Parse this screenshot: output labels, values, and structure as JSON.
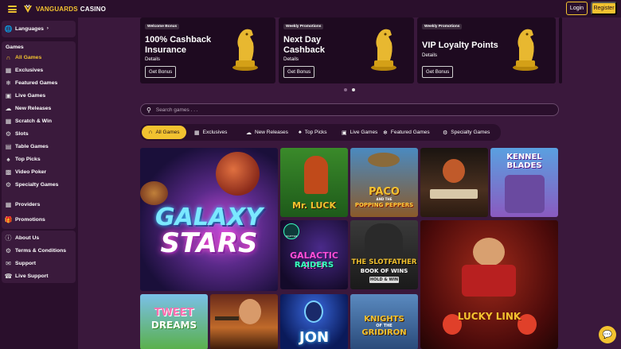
{
  "header": {
    "brand_prefix": "VANGUARDS",
    "brand_suffix": "CASINO",
    "login_label": "Login",
    "register_label": "Register",
    "accent": "#f2c230"
  },
  "sidebar": {
    "languages_label": "Languages",
    "games_heading": "Games",
    "games": [
      {
        "label": "All Games",
        "icon": "horseshoe-icon",
        "active": true
      },
      {
        "label": "Exclusives",
        "icon": "cards-icon"
      },
      {
        "label": "Featured Games",
        "icon": "featured-icon"
      },
      {
        "label": "Live Games",
        "icon": "live-icon"
      },
      {
        "label": "New Releases",
        "icon": "new-icon"
      },
      {
        "label": "Scratch & Win",
        "icon": "scratch-icon"
      },
      {
        "label": "Slots",
        "icon": "slots-icon"
      },
      {
        "label": "Table Games",
        "icon": "table-icon"
      },
      {
        "label": "Top Picks",
        "icon": "top-picks-icon"
      },
      {
        "label": "Video Poker",
        "icon": "video-poker-icon"
      },
      {
        "label": "Specialty Games",
        "icon": "specialty-icon"
      }
    ],
    "providers_label": "Providers",
    "promotions_label": "Promotions",
    "info": [
      {
        "label": "About Us",
        "icon": "info-icon"
      },
      {
        "label": "Terms & Conditions",
        "icon": "terms-icon"
      },
      {
        "label": "Support",
        "icon": "support-icon"
      },
      {
        "label": "Live Support",
        "icon": "live-support-icon"
      }
    ]
  },
  "promos": [
    {
      "tag": "Welcome Bonus",
      "title_line1": "100% Cashback",
      "title_line2": "Insurance",
      "details": "Details",
      "button": "Get Bonus"
    },
    {
      "tag": "Weekly Promotions",
      "title_line1": "Next Day",
      "title_line2": "Cashback",
      "details": "Details",
      "button": "Get Bonus"
    },
    {
      "tag": "Weekly Promotions",
      "title_line1": "VIP Loyalty Points",
      "title_line2": "",
      "details": "Details",
      "button": "Get Bonus"
    }
  ],
  "search": {
    "placeholder": "Search games . . ."
  },
  "tabs": [
    {
      "label": "All Games",
      "active": true
    },
    {
      "label": "Exclusives"
    },
    {
      "label": "New Releases"
    },
    {
      "label": "Top Picks"
    },
    {
      "label": "Live Games"
    },
    {
      "label": "Featured Games"
    },
    {
      "label": "Specialty Games"
    }
  ],
  "games": {
    "galaxy_stars": {
      "line1": "GALAXY",
      "line2": "STARS"
    },
    "mr_luck": "Mr. LUCK",
    "paco": {
      "line1": "PACO",
      "line2": "AND THE",
      "line3": "POPPING PEPPERS"
    },
    "kennel_blades": {
      "line1": "KENNEL",
      "line2": "BLADES"
    },
    "galactic_rift": {
      "badge": "SCATTER",
      "line1": "GALACTIC RIFT",
      "line2": "RAIDERS"
    },
    "slotfather": {
      "line1": "THE SLOTFATHER",
      "line2": "BOOK OF WINS",
      "line3": "HOLD & WIN"
    },
    "lucky_link": "LUCKY LINK",
    "tweet_dreams": {
      "line1": "TWEET",
      "line2": "DREAMS"
    },
    "jon": "JON",
    "knights": {
      "line1": "KNIGHTS",
      "line2": "OF THE",
      "line3": "GRIDIRON"
    }
  }
}
